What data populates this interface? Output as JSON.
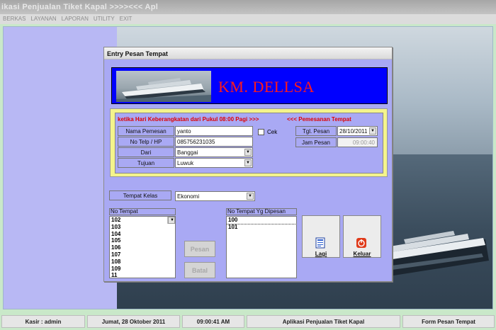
{
  "app": {
    "title": "ikasi Penjualan Tiket Kapal  >>>><<<  Apl",
    "menu": [
      "BERKAS",
      "LAYANAN",
      "LAPORAN",
      "UTILITY",
      "EXIT"
    ]
  },
  "dialog": {
    "title": "Entry Pesan Tempat",
    "banner_title": "KM. DELLSA",
    "notice_left": "ketika Hari Keberangkatan dari Pukul 08:00 Pagi >>>",
    "notice_right": "<<<  Pemesanan Tempat",
    "fields": {
      "nama_label": "Nama Pemesan",
      "nama_value": "yanto",
      "telp_label": "No Telp / HP",
      "telp_value": "085756231035",
      "dari_label": "Dari",
      "dari_value": "Banggai",
      "tujuan_label": "Tujuan",
      "tujuan_value": "Luwuk",
      "cek_label": "Cek",
      "tgl_label": "Tgl. Pesan",
      "tgl_value": "28/10/2011",
      "jam_label": "Jam Pesan",
      "jam_value": "09:00:40"
    },
    "kelas_label": "Tempat Kelas",
    "kelas_value": "Ekonomi",
    "list_tempat_header": "No Tempat",
    "list_tempat": [
      "102",
      "103",
      "104",
      "105",
      "106",
      "107",
      "108",
      "109",
      "11"
    ],
    "list_dipesan_header": "No Tempat Yg Dipesan",
    "list_dipesan": [
      "100",
      "101"
    ],
    "buttons": {
      "pesan": "Pesan",
      "batal": "Batal",
      "lagi": "Lagi",
      "keluar": "Keluar"
    }
  },
  "status": {
    "kasir": "Kasir : admin",
    "date": "Jumat, 28 Oktober 2011",
    "time": "09:00:41 AM",
    "app_name": "Aplikasi Penjualan Tiket Kapal",
    "form_name": "Form Pesan Tempat"
  },
  "colors": {
    "dialog_bg": "#a9a9f4",
    "banner_bg": "#0000ff",
    "banner_text": "#ff1a1a",
    "panel_yellow": "#f4f48c",
    "notice_red": "#e00000"
  }
}
